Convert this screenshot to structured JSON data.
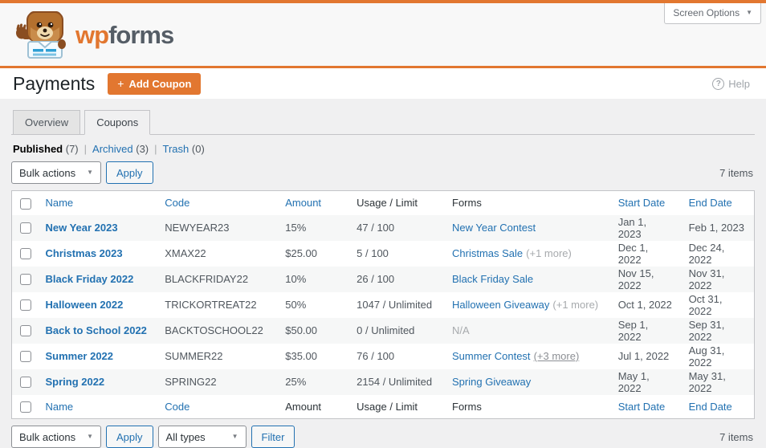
{
  "brand": {
    "logo_wp": "wp",
    "logo_forms": "forms",
    "screen_options_label": "Screen Options"
  },
  "page_header": {
    "title": "Payments",
    "add_coupon_label": "Add Coupon",
    "plus_icon": "+",
    "help_label": "Help",
    "help_icon": "?"
  },
  "tabs": [
    {
      "label": "Overview",
      "active": false
    },
    {
      "label": "Coupons",
      "active": true
    }
  ],
  "status_filters": [
    {
      "label": "Published",
      "count": "(7)",
      "current": true
    },
    {
      "label": "Archived",
      "count": "(3)",
      "current": false
    },
    {
      "label": "Trash",
      "count": "(0)",
      "current": false
    }
  ],
  "toolbar_top": {
    "bulk_actions_label": "Bulk actions",
    "apply_label": "Apply",
    "items_count": "7 items"
  },
  "toolbar_bottom": {
    "bulk_actions_label": "Bulk actions",
    "apply_label": "Apply",
    "type_filter_label": "All types",
    "filter_label": "Filter",
    "items_count": "7 items"
  },
  "table": {
    "columns_top": [
      {
        "label": "Name",
        "link": true
      },
      {
        "label": "Code",
        "link": true
      },
      {
        "label": "Amount",
        "link": true
      },
      {
        "label": "Usage / Limit",
        "link": false
      },
      {
        "label": "Forms",
        "link": false
      },
      {
        "label": "Start Date",
        "link": true
      },
      {
        "label": "End Date",
        "link": true
      }
    ],
    "columns_bottom": [
      {
        "label": "Name",
        "link": true
      },
      {
        "label": "Code",
        "link": true
      },
      {
        "label": "Amount",
        "link": false
      },
      {
        "label": "Usage / Limit",
        "link": false
      },
      {
        "label": "Forms",
        "link": false
      },
      {
        "label": "Start Date",
        "link": true
      },
      {
        "label": "End Date",
        "link": true
      }
    ],
    "rows": [
      {
        "name": "New Year 2023",
        "code": "NEWYEAR23",
        "amount": "15%",
        "usage": "47 / 100",
        "forms": {
          "link": "New Year Contest"
        },
        "start": "Jan 1, 2023",
        "end": "Feb 1, 2023"
      },
      {
        "name": "Christmas 2023",
        "code": "XMAX22",
        "amount": "$25.00",
        "usage": "5 / 100",
        "forms": {
          "link": "Christmas Sale",
          "extra": "(+1 more)"
        },
        "start": "Dec 1, 2022",
        "end": "Dec 24, 2022"
      },
      {
        "name": "Black Friday 2022",
        "code": "BLACKFRIDAY22",
        "amount": "10%",
        "usage": "26 / 100",
        "forms": {
          "link": "Black Friday Sale"
        },
        "start": "Nov 15, 2022",
        "end": "Nov 31, 2022"
      },
      {
        "name": "Halloween 2022",
        "code": "TRICKORTREAT22",
        "amount": "50%",
        "usage": "1047 / Unlimited",
        "forms": {
          "link": "Halloween Giveaway",
          "extra": "(+1 more)"
        },
        "start": "Oct 1, 2022",
        "end": "Oct 31, 2022"
      },
      {
        "name": "Back to School 2022",
        "code": "BACKTOSCHOOL22",
        "amount": "$50.00",
        "usage": "0 / Unlimited",
        "forms": {
          "text": "N/A"
        },
        "start": "Sep 1, 2022",
        "end": "Sep 31, 2022"
      },
      {
        "name": "Summer 2022",
        "code": "SUMMER22",
        "amount": "$35.00",
        "usage": "76 / 100",
        "forms": {
          "link": "Summer Contest",
          "extra": "(+3 more)",
          "extra_underlined": true
        },
        "start": "Jul 1, 2022",
        "end": "Aug 31, 2022"
      },
      {
        "name": "Spring 2022",
        "code": "SPRING22",
        "amount": "25%",
        "usage": "2154 / Unlimited",
        "forms": {
          "link": "Spring Giveaway"
        },
        "start": "May 1, 2022",
        "end": "May 31, 2022"
      }
    ]
  },
  "colors": {
    "accent_orange": "#e27730",
    "link_blue": "#2271b1",
    "muted_gray": "#a7aaad",
    "table_border": "#c3c4c7"
  }
}
